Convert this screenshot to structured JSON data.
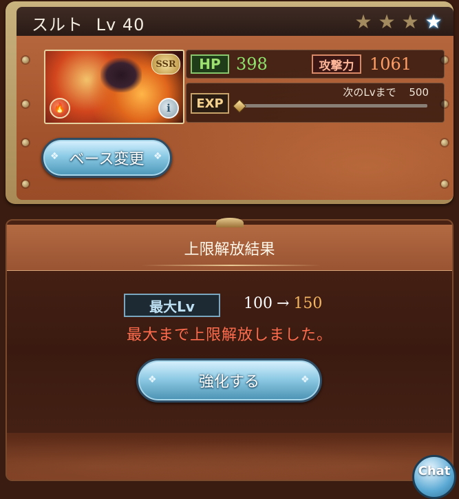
{
  "character": {
    "name": "スルト",
    "level_text": "Lv 40",
    "rarity_badge": "SSR",
    "stars_filled": 3,
    "stars_total": 4,
    "element_icon": "fire-icon",
    "info_icon_label": "i"
  },
  "stats": {
    "hp_label": "HP",
    "hp_value": "398",
    "attack_label": "攻撃力",
    "attack_value": "1061",
    "exp_label": "EXP",
    "next_level_label": "次のLvまで",
    "next_level_value": "500",
    "exp_progress": 0
  },
  "base_change_button": {
    "label": "ベース変更"
  },
  "result": {
    "title": "上限解放結果",
    "max_lv_label": "最大Lv",
    "lv_from": "100",
    "arrow": "→",
    "lv_to": "150",
    "message": "最大まで上限解放しました。"
  },
  "enhance_button": {
    "label": "強化する"
  },
  "chat_button": {
    "label": "Chat"
  },
  "colors": {
    "hp": "#8fe36d",
    "attack": "#ff9e66",
    "lv_to": "#f3b662",
    "message": "#ff6d4e"
  }
}
